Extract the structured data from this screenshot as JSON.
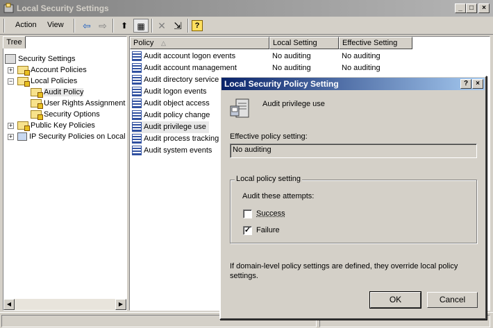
{
  "window": {
    "title": "Local Security Settings",
    "minimize": "_",
    "maximize": "□",
    "close": "×"
  },
  "menu": {
    "action": "Action",
    "view": "View"
  },
  "toolbar": {
    "back": "⇦",
    "forward": "⇨",
    "up": "⬆",
    "show_hide": "▦",
    "delete": "✕",
    "export": "⇲",
    "help": "?"
  },
  "tree": {
    "tab": "Tree",
    "root": "Security Settings",
    "account_policies": "Account Policies",
    "local_policies": "Local Policies",
    "audit_policy": "Audit Policy",
    "user_rights": "User Rights Assignment",
    "security_options": "Security Options",
    "public_key": "Public Key Policies",
    "ip_security": "IP Security Policies on Local"
  },
  "list": {
    "columns": {
      "policy": "Policy",
      "local": "Local Setting",
      "effective": "Effective Setting",
      "sort_icon": "△"
    },
    "rows": [
      {
        "policy": "Audit account logon events",
        "local": "No auditing",
        "effective": "No auditing"
      },
      {
        "policy": "Audit account management",
        "local": "No auditing",
        "effective": "No auditing"
      },
      {
        "policy": "Audit directory service"
      },
      {
        "policy": "Audit logon events"
      },
      {
        "policy": "Audit object access"
      },
      {
        "policy": "Audit policy change"
      },
      {
        "policy": "Audit privilege use"
      },
      {
        "policy": "Audit process tracking"
      },
      {
        "policy": "Audit system events"
      }
    ]
  },
  "dialog": {
    "title": "Local Security Policy Setting",
    "help_btn": "?",
    "close_btn": "×",
    "policy_name": "Audit privilege use",
    "effective_label": "Effective policy setting:",
    "effective_value": "No auditing",
    "local_group": "Local policy setting",
    "audit_attempts": "Audit these attempts:",
    "success_label": "Success",
    "success_checked": false,
    "failure_label": "Failure",
    "failure_checked": true,
    "note": "If domain-level policy settings are defined, they override local policy settings.",
    "ok": "OK",
    "cancel": "Cancel"
  }
}
